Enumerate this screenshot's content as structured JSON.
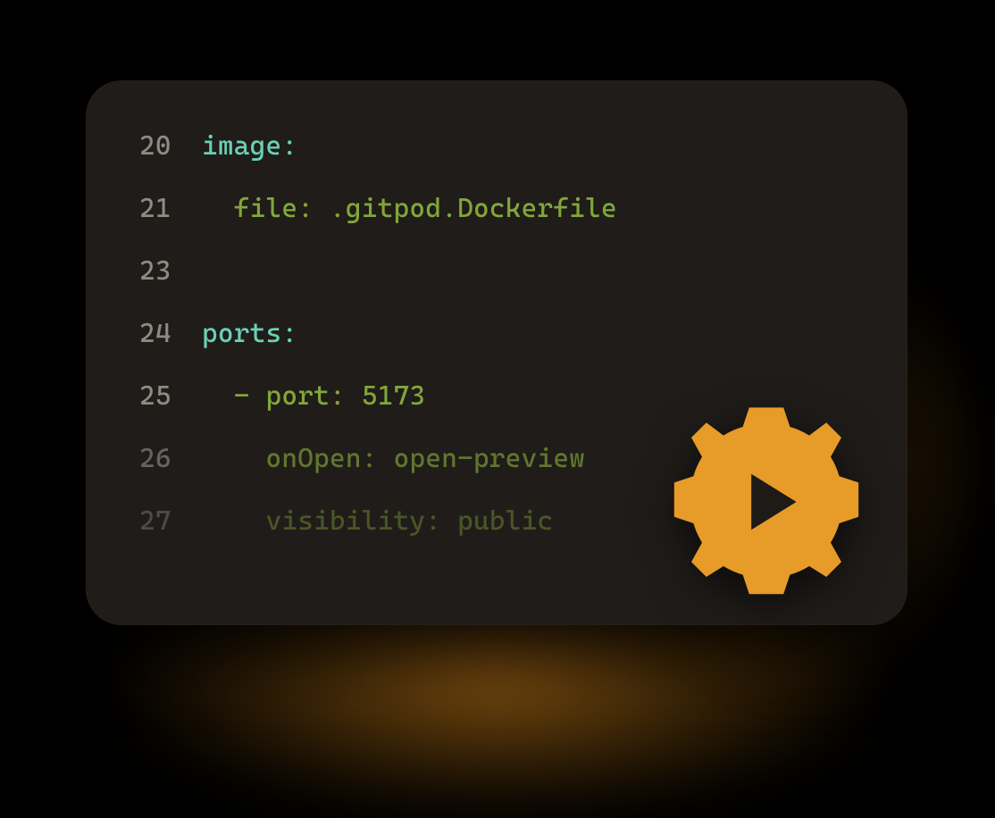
{
  "colors": {
    "background": "#1f1c19",
    "line_number": "#8f8a83",
    "key_teal": "#6bcfb6",
    "value_green": "#82a63a",
    "gear": "#e79b28"
  },
  "icons": {
    "gear_play": "gear-play-icon"
  },
  "code": {
    "lines": [
      {
        "num": "20",
        "indent": "",
        "tokens": [
          {
            "t": "image",
            "c": "key"
          },
          {
            "t": ":",
            "c": "punct-teal"
          }
        ]
      },
      {
        "num": "21",
        "indent": "  ",
        "tokens": [
          {
            "t": "file",
            "c": "sub"
          },
          {
            "t": ": ",
            "c": "punct"
          },
          {
            "t": ".gitpod.Dockerfile",
            "c": "sub"
          }
        ]
      },
      {
        "num": "23",
        "indent": "",
        "tokens": []
      },
      {
        "num": "24",
        "indent": "",
        "tokens": [
          {
            "t": "ports",
            "c": "key"
          },
          {
            "t": ":",
            "c": "punct-teal"
          }
        ]
      },
      {
        "num": "25",
        "indent": "  ",
        "tokens": [
          {
            "t": "- ",
            "c": "punct"
          },
          {
            "t": "port",
            "c": "sub"
          },
          {
            "t": ": ",
            "c": "punct"
          },
          {
            "t": "5173",
            "c": "sub"
          }
        ]
      },
      {
        "num": "26",
        "indent": "    ",
        "fade": "1",
        "tokens": [
          {
            "t": "onOpen",
            "c": "sub"
          },
          {
            "t": ": ",
            "c": "punct"
          },
          {
            "t": "open-preview",
            "c": "sub"
          }
        ]
      },
      {
        "num": "27",
        "indent": "    ",
        "fade": "2",
        "tokens": [
          {
            "t": "visibility",
            "c": "sub"
          },
          {
            "t": ": ",
            "c": "punct"
          },
          {
            "t": "public",
            "c": "sub"
          }
        ]
      }
    ]
  }
}
